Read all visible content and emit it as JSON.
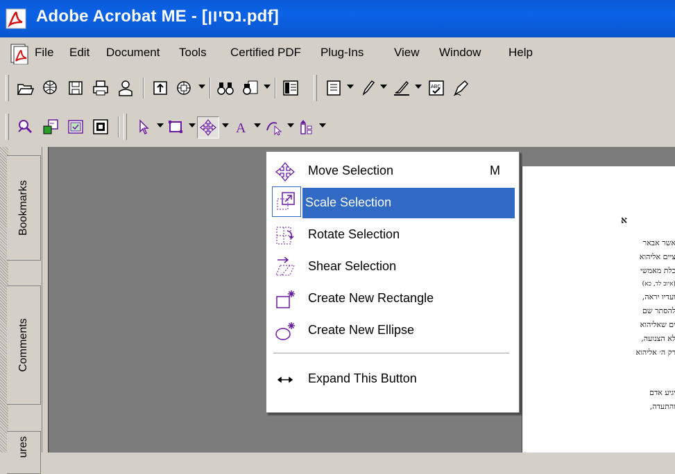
{
  "window": {
    "title": "Adobe Acrobat ME - [נסיון.pdf]"
  },
  "menubar": {
    "items": [
      "File",
      "Edit",
      "Document",
      "Tools",
      "Certified PDF",
      "Plug-Ins",
      "View",
      "Window",
      "Help"
    ]
  },
  "navpane": {
    "tabs": [
      "Bookmarks",
      "Comments",
      "ures"
    ]
  },
  "dropdown": {
    "items": [
      {
        "label": "Move Selection",
        "shortcut": "M",
        "icon": "move-selection-icon"
      },
      {
        "label": "Scale Selection",
        "icon": "scale-selection-icon",
        "selected": true
      },
      {
        "label": "Rotate Selection",
        "icon": "rotate-selection-icon"
      },
      {
        "label": "Shear Selection",
        "icon": "shear-selection-icon"
      },
      {
        "label": "Create New Rectangle",
        "icon": "new-rectangle-icon"
      },
      {
        "label": "Create New Ellipse",
        "icon": "new-ellipse-icon"
      },
      {
        "label": "Expand This Button",
        "icon": "expand-arrows-icon"
      }
    ]
  },
  "document": {
    "page_letter": "א",
    "lines": [
      "אשר אבאר",
      "ציים אליהוא",
      "כלת מאמשי",
      "(איוב לד, כא)",
      "ועדיו יראה,",
      "להסתר שם",
      "ים שאליהוא",
      "לא הצנועה,",
      "רק ה׳ אליהוא",
      "יגיע אדם",
      "והתעדה,"
    ]
  },
  "colors": {
    "titlebar": "#0b62e6",
    "selection": "#316ac5",
    "workspace": "#7c7c7c",
    "chrome": "#d4d0c8"
  }
}
